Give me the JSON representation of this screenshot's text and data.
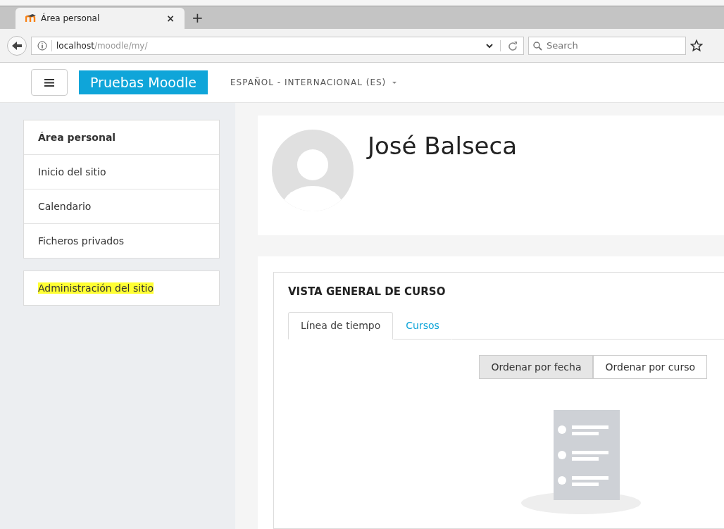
{
  "browser": {
    "tab": {
      "title": "Área personal",
      "close": "×",
      "new_tab": "+"
    },
    "url": {
      "host": "localhost",
      "path": "/moodle/my/"
    },
    "search": {
      "placeholder": "Search"
    }
  },
  "navbar": {
    "site_name": "Pruebas Moodle",
    "language": "ESPAÑOL - INTERNACIONAL (ES)"
  },
  "sidebar": {
    "groups": [
      {
        "highlighted": false,
        "items": [
          {
            "label": "Área personal",
            "selected": true
          },
          {
            "label": "Inicio del sitio",
            "selected": false
          },
          {
            "label": "Calendario",
            "selected": false
          },
          {
            "label": "Ficheros privados",
            "selected": false
          }
        ]
      },
      {
        "highlighted": true,
        "items": [
          {
            "label": "Administración del sitio",
            "selected": false
          }
        ]
      }
    ]
  },
  "profile": {
    "name": "José Balseca"
  },
  "course_overview": {
    "title": "VISTA GENERAL DE CURSO",
    "tabs": [
      {
        "label": "Línea de tiempo",
        "selected": true
      },
      {
        "label": "Cursos",
        "selected": false
      }
    ],
    "sort_buttons": [
      {
        "label": "Ordenar por fecha",
        "selected": true
      },
      {
        "label": "Ordenar por curso",
        "selected": false
      }
    ]
  }
}
